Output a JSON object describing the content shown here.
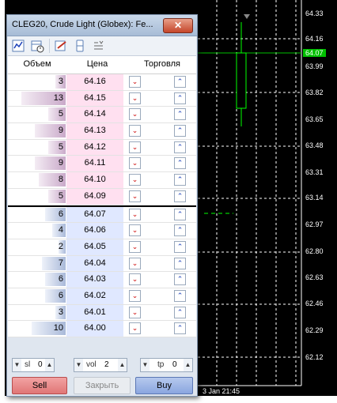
{
  "window": {
    "title": "CLEG20, Crude Light (Globex): Fe...",
    "close_glyph": "✕"
  },
  "toolbar": {
    "icons": [
      "chart-icon",
      "calendar-icon",
      "edit-icon",
      "sliders-icon",
      "list-icon"
    ]
  },
  "columns": {
    "volume": "Объем",
    "price": "Цена",
    "trade": "Торговля"
  },
  "asks": [
    {
      "volume": "3",
      "price": "64.16"
    },
    {
      "volume": "13",
      "price": "64.15"
    },
    {
      "volume": "5",
      "price": "64.14"
    },
    {
      "volume": "9",
      "price": "64.13"
    },
    {
      "volume": "5",
      "price": "64.12"
    },
    {
      "volume": "9",
      "price": "64.11"
    },
    {
      "volume": "8",
      "price": "64.10"
    },
    {
      "volume": "5",
      "price": "64.09"
    }
  ],
  "bids": [
    {
      "volume": "6",
      "price": "64.07"
    },
    {
      "volume": "4",
      "price": "64.06"
    },
    {
      "volume": "2",
      "price": "64.05"
    },
    {
      "volume": "7",
      "price": "64.04"
    },
    {
      "volume": "6",
      "price": "64.03"
    },
    {
      "volume": "6",
      "price": "64.02"
    },
    {
      "volume": "3",
      "price": "64.01"
    },
    {
      "volume": "10",
      "price": "64.00"
    }
  ],
  "controls": {
    "sl_label": "sl",
    "sl_value": "0",
    "vol_label": "vol",
    "vol_value": "2",
    "tp_label": "tp",
    "tp_value": "0"
  },
  "buttons": {
    "sell": "Sell",
    "close": "Закрыть",
    "buy": "Buy"
  },
  "chart": {
    "price_labels": [
      "64.33",
      "64.16",
      "64.07",
      "63.99",
      "63.82",
      "63.65",
      "63.48",
      "63.31",
      "63.14",
      "62.97",
      "62.80",
      "62.63",
      "62.46",
      "62.29",
      "62.12"
    ],
    "current_price": "64.07",
    "time_label": "3 Jan 21:45",
    "colors": {
      "grid": "#ffffff",
      "candle": "#00ff00",
      "ask_bar": "#c9a9c9",
      "bid_bar": "#a9b9d9",
      "ask_price_bg": "#ffe0f0",
      "bid_price_bg": "#e0e8ff"
    }
  }
}
